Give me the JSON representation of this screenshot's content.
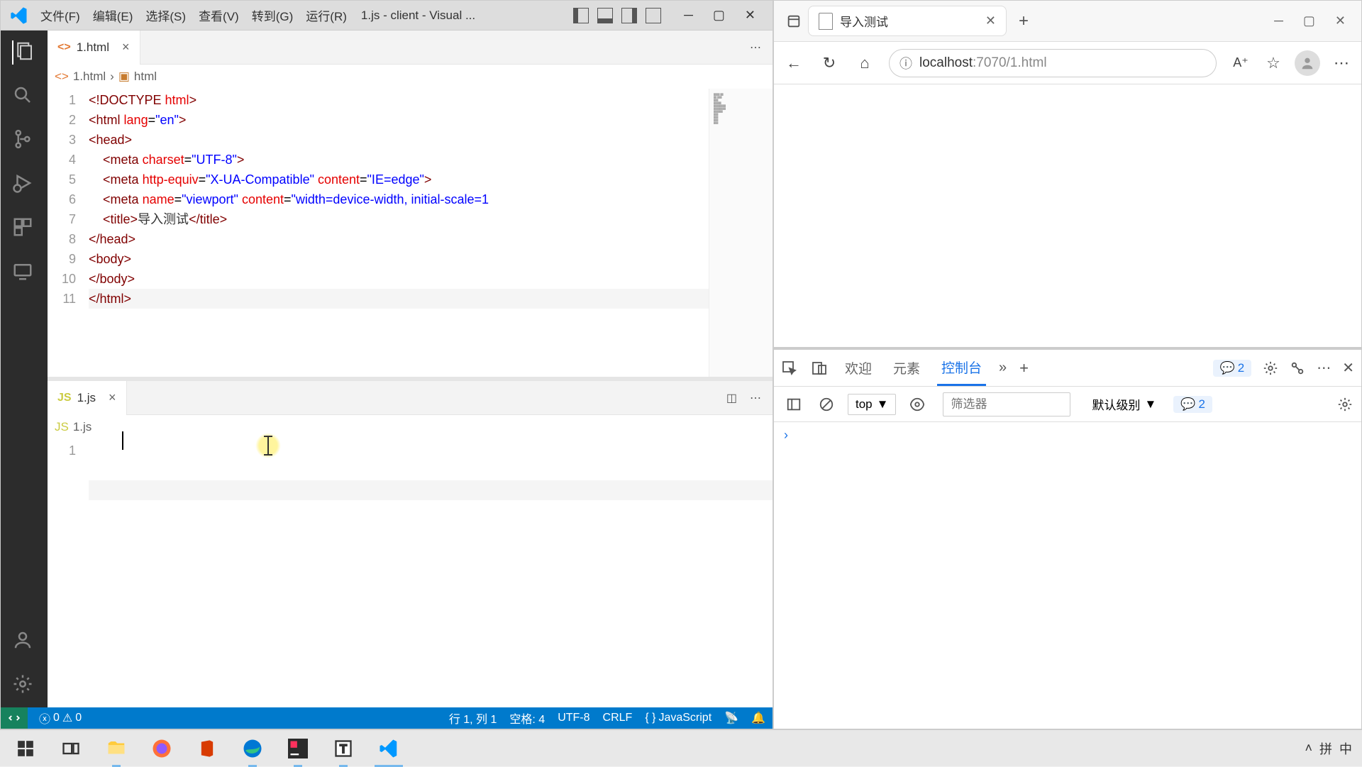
{
  "vscode": {
    "menu": [
      "文件(F)",
      "编辑(E)",
      "选择(S)",
      "查看(V)",
      "转到(G)",
      "运行(R)"
    ],
    "title": "1.js - client - Visual ...",
    "tabs": {
      "top": {
        "filename": "1.html"
      },
      "bottom": {
        "filename": "1.js"
      }
    },
    "breadcrumb_top": {
      "file": "1.html",
      "symbol": "html"
    },
    "breadcrumb_bottom": {
      "file": "1.js"
    },
    "code_lines": [
      {
        "n": "1",
        "html": "<span class='tok-tag'>&lt;!</span><span class='tok-doc'>DOCTYPE</span> <span class='tok-attr'>html</span><span class='tok-tag'>&gt;</span>"
      },
      {
        "n": "2",
        "html": "<span class='tok-tag'>&lt;html</span> <span class='tok-attr'>lang</span>=<span class='tok-str'>\"en\"</span><span class='tok-tag'>&gt;</span>"
      },
      {
        "n": "3",
        "html": "<span class='tok-tag'>&lt;head&gt;</span>"
      },
      {
        "n": "4",
        "html": "    <span class='tok-tag'>&lt;meta</span> <span class='tok-attr'>charset</span>=<span class='tok-str'>\"UTF-8\"</span><span class='tok-tag'>&gt;</span>"
      },
      {
        "n": "5",
        "html": "    <span class='tok-tag'>&lt;meta</span> <span class='tok-attr'>http-equiv</span>=<span class='tok-str'>\"X-UA-Compatible\"</span> <span class='tok-attr'>content</span>=<span class='tok-str'>\"IE=edge\"</span><span class='tok-tag'>&gt;</span>"
      },
      {
        "n": "6",
        "html": "    <span class='tok-tag'>&lt;meta</span> <span class='tok-attr'>name</span>=<span class='tok-str'>\"viewport\"</span> <span class='tok-attr'>content</span>=<span class='tok-str'>\"width=device-width, initial-scale=1</span>"
      },
      {
        "n": "7",
        "html": "    <span class='tok-tag'>&lt;title&gt;</span><span class='tok-txt'>导入测试</span><span class='tok-tag'>&lt;/title&gt;</span>"
      },
      {
        "n": "8",
        "html": "<span class='tok-tag'>&lt;/head&gt;</span>"
      },
      {
        "n": "9",
        "html": "<span class='tok-tag'>&lt;body&gt;</span>"
      },
      {
        "n": "10",
        "html": "<span class='tok-tag'>&lt;/body&gt;</span>"
      },
      {
        "n": "11",
        "html": "<span class='tok-tag'>&lt;/html&gt;</span>"
      }
    ],
    "js_lines": [
      {
        "n": "1",
        "html": ""
      }
    ],
    "status": {
      "errors": "0",
      "warnings": "0",
      "cursor": "行 1, 列 1",
      "spaces": "空格: 4",
      "encoding": "UTF-8",
      "eol": "CRLF",
      "lang": "JavaScript"
    }
  },
  "browser": {
    "tab_title": "导入测试",
    "url_host": "localhost",
    "url_path": ":7070/1.html"
  },
  "devtools": {
    "tabs": {
      "welcome": "欢迎",
      "elements": "元素",
      "console": "控制台"
    },
    "issue_count": "2",
    "context": "top",
    "filter_placeholder": "筛选器",
    "level": "默认级别",
    "msg_count": "2"
  },
  "ime": {
    "pinyin": "拼",
    "zhong": "中"
  }
}
